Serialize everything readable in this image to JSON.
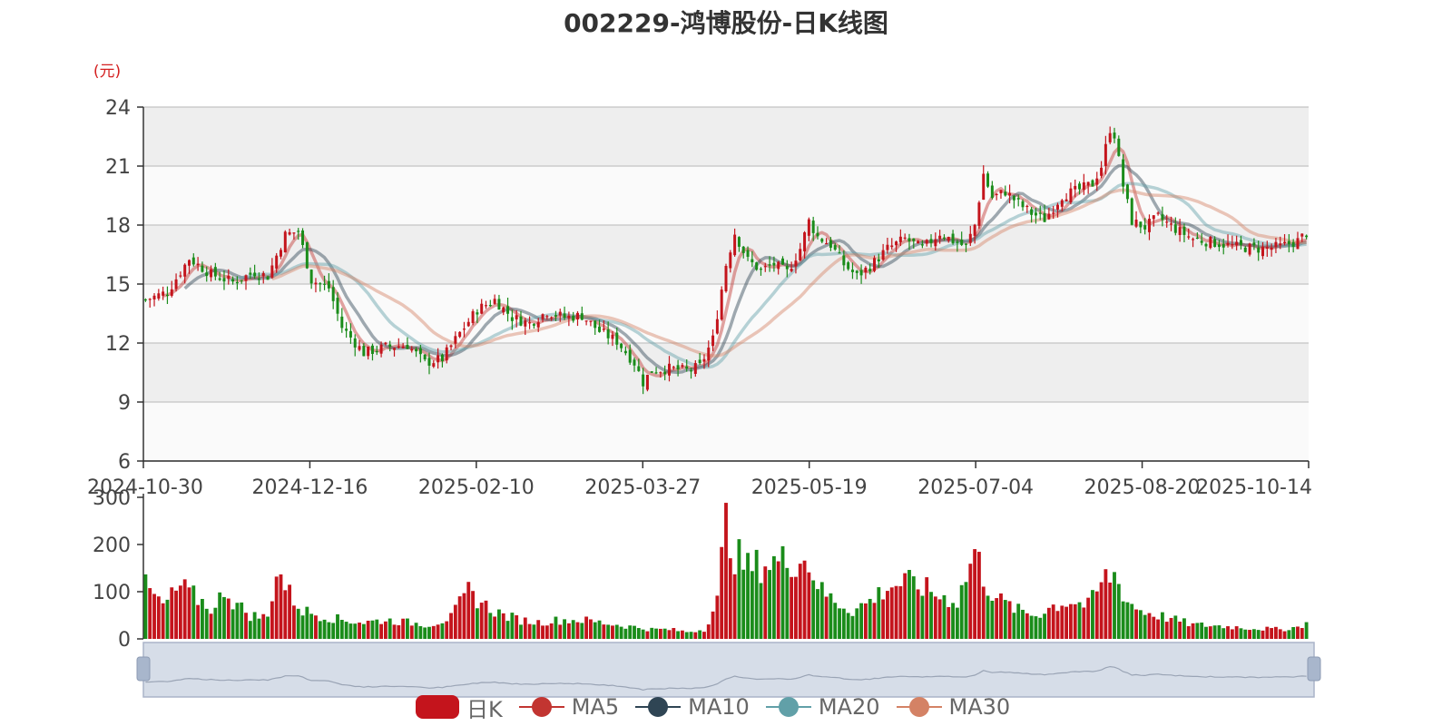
{
  "title": "002229-鸿博股份-日K线图",
  "colors": {
    "up": "#c4141c",
    "down": "#1a8c1a",
    "ma5": "#c23531",
    "ma10": "#2f4554",
    "ma20": "#61a0a8",
    "ma30": "#d48265",
    "band": "#eeeeee",
    "band_alt": "#fafafa",
    "slider_fill": "#d6dde8"
  },
  "legend": [
    {
      "key": "k",
      "label": "日K",
      "icon": "rounded-rect-icon",
      "color": "#c4141c"
    },
    {
      "key": "ma5",
      "label": "MA5",
      "icon": "line-circle-icon",
      "color": "#c23531"
    },
    {
      "key": "ma10",
      "label": "MA10",
      "icon": "line-circle-icon",
      "color": "#2f4554"
    },
    {
      "key": "ma20",
      "label": "MA20",
      "icon": "line-circle-icon",
      "color": "#61a0a8"
    },
    {
      "key": "ma30",
      "label": "MA30",
      "icon": "line-circle-icon",
      "color": "#d48265"
    }
  ],
  "chart_data": {
    "type": "candlestick",
    "price_axis": {
      "unit_label": "(元)",
      "ticks": [
        6,
        9,
        12,
        15,
        18,
        21,
        24
      ],
      "ylim": [
        6,
        24
      ]
    },
    "volume_axis": {
      "ticks": [
        0,
        100,
        200,
        300
      ],
      "ylim": [
        0,
        300
      ]
    },
    "x_tick_labels": [
      "2024-10-30",
      "2024-12-16",
      "2025-02-10",
      "2025-03-27",
      "2025-05-19",
      "2025-07-04",
      "2025-08-20",
      "2025-10-14"
    ],
    "trading_days": 234,
    "price_anchors": [
      [
        0,
        14.2
      ],
      [
        5,
        14.6
      ],
      [
        10,
        16.3
      ],
      [
        15,
        15.5
      ],
      [
        20,
        15.1
      ],
      [
        25,
        15.6
      ],
      [
        28,
        15.4
      ],
      [
        32,
        17.5
      ],
      [
        35,
        17.7
      ],
      [
        38,
        15.2
      ],
      [
        42,
        14.8
      ],
      [
        45,
        12.8
      ],
      [
        50,
        11.5
      ],
      [
        55,
        11.8
      ],
      [
        60,
        11.9
      ],
      [
        64,
        11.0
      ],
      [
        68,
        11.2
      ],
      [
        72,
        12.5
      ],
      [
        76,
        13.7
      ],
      [
        80,
        14.2
      ],
      [
        84,
        13.3
      ],
      [
        88,
        13.0
      ],
      [
        92,
        13.6
      ],
      [
        96,
        13.3
      ],
      [
        100,
        13.4
      ],
      [
        104,
        12.6
      ],
      [
        108,
        12.1
      ],
      [
        112,
        11.0
      ],
      [
        114,
        10.0
      ],
      [
        116,
        10.6
      ],
      [
        120,
        10.7
      ],
      [
        124,
        10.6
      ],
      [
        127,
        10.8
      ],
      [
        130,
        12.2
      ],
      [
        133,
        16.0
      ],
      [
        135,
        17.6
      ],
      [
        138,
        16.2
      ],
      [
        141,
        15.7
      ],
      [
        144,
        16.0
      ],
      [
        147,
        15.6
      ],
      [
        150,
        16.8
      ],
      [
        152,
        18.2
      ],
      [
        154,
        17.4
      ],
      [
        157,
        17.0
      ],
      [
        160,
        16.0
      ],
      [
        163,
        15.4
      ],
      [
        166,
        15.9
      ],
      [
        170,
        16.8
      ],
      [
        174,
        17.3
      ],
      [
        178,
        16.8
      ],
      [
        182,
        17.6
      ],
      [
        185,
        17.2
      ],
      [
        188,
        16.9
      ],
      [
        190,
        18.0
      ],
      [
        192,
        20.6
      ],
      [
        194,
        19.4
      ],
      [
        197,
        19.7
      ],
      [
        200,
        19.1
      ],
      [
        203,
        18.6
      ],
      [
        206,
        18.3
      ],
      [
        210,
        19.5
      ],
      [
        214,
        19.8
      ],
      [
        217,
        20.1
      ],
      [
        219,
        21.0
      ],
      [
        221,
        22.9
      ],
      [
        222,
        22.6
      ],
      [
        224,
        20.0
      ],
      [
        226,
        18.2
      ],
      [
        229,
        17.9
      ],
      [
        232,
        18.4
      ],
      [
        236,
        17.8
      ],
      [
        240,
        17.3
      ],
      [
        245,
        17.1
      ],
      [
        250,
        16.9
      ],
      [
        255,
        16.8
      ],
      [
        260,
        16.9
      ],
      [
        264,
        17.2
      ],
      [
        266,
        17.6
      ]
    ],
    "volume_anchors": [
      [
        0,
        110
      ],
      [
        4,
        70
      ],
      [
        8,
        110
      ],
      [
        12,
        85
      ],
      [
        16,
        60
      ],
      [
        18,
        110
      ],
      [
        20,
        80
      ],
      [
        24,
        50
      ],
      [
        28,
        45
      ],
      [
        30,
        150
      ],
      [
        33,
        95
      ],
      [
        36,
        60
      ],
      [
        40,
        50
      ],
      [
        45,
        40
      ],
      [
        50,
        35
      ],
      [
        55,
        40
      ],
      [
        60,
        35
      ],
      [
        65,
        30
      ],
      [
        70,
        45
      ],
      [
        74,
        100
      ],
      [
        78,
        70
      ],
      [
        82,
        50
      ],
      [
        86,
        40
      ],
      [
        90,
        35
      ],
      [
        95,
        40
      ],
      [
        100,
        40
      ],
      [
        104,
        35
      ],
      [
        108,
        30
      ],
      [
        112,
        25
      ],
      [
        116,
        20
      ],
      [
        120,
        20
      ],
      [
        124,
        15
      ],
      [
        128,
        20
      ],
      [
        131,
        80
      ],
      [
        133,
        250
      ],
      [
        135,
        180
      ],
      [
        138,
        150
      ],
      [
        142,
        160
      ],
      [
        146,
        165
      ],
      [
        150,
        170
      ],
      [
        152,
        160
      ],
      [
        155,
        100
      ],
      [
        158,
        80
      ],
      [
        162,
        60
      ],
      [
        166,
        80
      ],
      [
        170,
        110
      ],
      [
        174,
        120
      ],
      [
        178,
        110
      ],
      [
        182,
        90
      ],
      [
        186,
        80
      ],
      [
        188,
        130
      ],
      [
        190,
        185
      ],
      [
        193,
        110
      ],
      [
        196,
        80
      ],
      [
        200,
        60
      ],
      [
        204,
        50
      ],
      [
        208,
        70
      ],
      [
        212,
        80
      ],
      [
        216,
        70
      ],
      [
        218,
        100
      ],
      [
        220,
        130
      ],
      [
        222,
        135
      ],
      [
        225,
        80
      ],
      [
        228,
        60
      ],
      [
        232,
        50
      ],
      [
        236,
        40
      ],
      [
        240,
        30
      ],
      [
        245,
        28
      ],
      [
        250,
        25
      ],
      [
        255,
        22
      ],
      [
        260,
        20
      ],
      [
        264,
        25
      ],
      [
        266,
        35
      ]
    ]
  }
}
